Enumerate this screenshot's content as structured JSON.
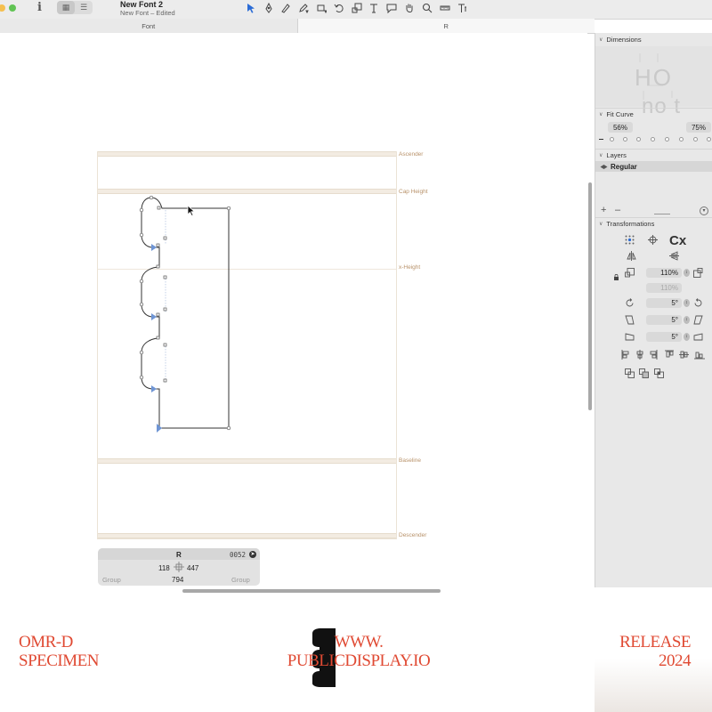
{
  "window": {
    "title": "New Font 2",
    "subtitle": "New Font – Edited",
    "info_label": "i"
  },
  "tabs": [
    {
      "label": "Font",
      "active": false
    },
    {
      "label": "R",
      "active": true
    }
  ],
  "toolbar": {
    "tools": [
      "select-icon",
      "pen-icon",
      "pen-curve-icon",
      "pen-dropdown-icon",
      "rectangle-icon",
      "rotate-icon",
      "scale-icon",
      "text-icon",
      "comment-icon",
      "hand-icon",
      "zoom-icon",
      "ruler-icon",
      "text-options-icon"
    ]
  },
  "metrics": {
    "ascender": "Ascender",
    "cap_height": "Cap Height",
    "x_height": "x-Height",
    "baseline": "Baseline",
    "descender": "Descender"
  },
  "glyph_info": {
    "name": "R",
    "unicode": "0052",
    "lsb": "118",
    "rsb": "447",
    "width": "794",
    "left_group": "Group",
    "right_group": "Group"
  },
  "sidebar": {
    "dimensions": {
      "title": "Dimensions",
      "preview_top": "HO",
      "preview_bottom": "no t"
    },
    "fit_curve": {
      "title": "Fit Curve",
      "min": "56%",
      "max": "75%"
    },
    "layers": {
      "title": "Layers",
      "items": [
        "Regular"
      ],
      "add_label": "+",
      "remove_label": "–"
    },
    "transformations": {
      "title": "Transformations",
      "cx_label": "Cx",
      "scale_x": "110%",
      "scale_y": "110%",
      "rotate": "5°",
      "slant": "5°",
      "skew": "5°"
    }
  },
  "specimen": {
    "left_line1": "OMR-D",
    "left_line2": "SPECIMEN",
    "center_line1": "WWW.",
    "center_line2": "PUBLICDISPLAY.IO",
    "right_line1": "RELEASE",
    "right_line2": "2024"
  },
  "colors": {
    "accent": "#e04a33",
    "selection": "#2b6cd6",
    "metric_label": "#b8926a"
  }
}
